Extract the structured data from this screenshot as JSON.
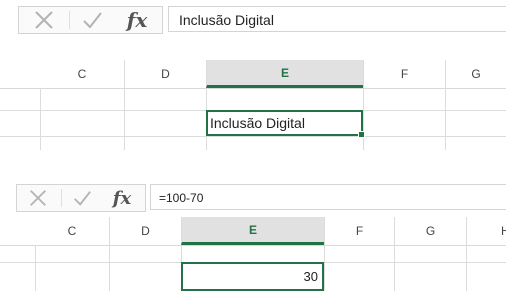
{
  "panel1": {
    "formula_bar": {
      "cancel_icon": "x-icon",
      "enter_icon": "checkmark-icon",
      "fx_label": "fx",
      "content": "Inclusão Digital"
    },
    "columns": [
      "C",
      "D",
      "E",
      "F",
      "G"
    ],
    "selected_column": "E",
    "active_cell_value": "Inclusão Digital"
  },
  "panel2": {
    "formula_bar": {
      "cancel_icon": "x-icon",
      "enter_icon": "checkmark-icon",
      "fx_label": "fx",
      "content": "=100-70"
    },
    "columns": [
      "C",
      "D",
      "E",
      "F",
      "G",
      "H"
    ],
    "selected_column": "E",
    "active_cell_value": "30"
  },
  "colors": {
    "accent": "#217346",
    "header_selected_bg": "#e1e1e1",
    "gridline": "#dcdcdc"
  }
}
